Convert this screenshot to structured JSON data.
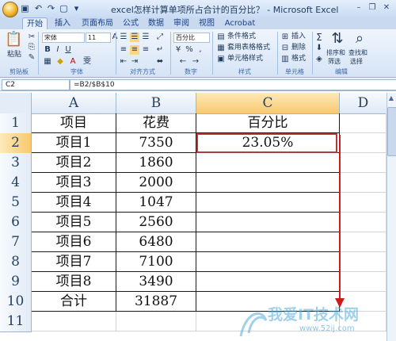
{
  "window": {
    "title": "excel怎样计算单项所占合计的百分比？ - Microsoft Excel",
    "controls": [
      "minimize",
      "restore",
      "close"
    ]
  },
  "tabs": [
    "开始",
    "插入",
    "页面布局",
    "公式",
    "数据",
    "审阅",
    "视图",
    "Acrobat"
  ],
  "active_tab": "开始",
  "ribbon": {
    "clipboard": {
      "paste": "粘贴",
      "label": "剪贴板"
    },
    "font": {
      "name": "宋体",
      "size": "11",
      "label": "字体",
      "bold": "B",
      "italic": "I",
      "underline": "U",
      "grow": "A",
      "color_letter": "A",
      "phonetic": "雯"
    },
    "alignment": {
      "label": "对齐方式"
    },
    "number": {
      "format": "百分比",
      "label": "数字"
    },
    "styles": {
      "conditional": "条件格式",
      "table": "套用表格格式",
      "cell": "单元格样式",
      "label": "样式"
    },
    "cells": {
      "insert": "插入",
      "delete": "删除",
      "format": "格式",
      "label": "单元格"
    },
    "editing": {
      "sum": "Σ",
      "sort": "排序和",
      "sort2": "筛选",
      "find": "查找和",
      "find2": "选择",
      "label": "编辑"
    }
  },
  "formula_bar": {
    "name_box": "C2",
    "formula": "=B2/$B$10"
  },
  "columns": [
    "A",
    "B",
    "C",
    "D"
  ],
  "selected_column": "C",
  "rows": [
    {
      "num": "1",
      "a": "项目",
      "b": "花费",
      "c": "百分比"
    },
    {
      "num": "2",
      "a": "项目1",
      "b": "7350",
      "c": "23.05%"
    },
    {
      "num": "3",
      "a": "项目2",
      "b": "1860",
      "c": ""
    },
    {
      "num": "4",
      "a": "项目3",
      "b": "2000",
      "c": ""
    },
    {
      "num": "5",
      "a": "项目4",
      "b": "1047",
      "c": ""
    },
    {
      "num": "6",
      "a": "项目5",
      "b": "2560",
      "c": ""
    },
    {
      "num": "7",
      "a": "项目6",
      "b": "6480",
      "c": ""
    },
    {
      "num": "8",
      "a": "项目7",
      "b": "7100",
      "c": ""
    },
    {
      "num": "9",
      "a": "项目8",
      "b": "3490",
      "c": ""
    },
    {
      "num": "10",
      "a": "合计",
      "b": "31887",
      "c": ""
    },
    {
      "num": "11",
      "a": "",
      "b": "",
      "c": ""
    }
  ],
  "selected_row": "2",
  "watermark": {
    "text": "我爱IT技术网",
    "url": "www.52ij.com"
  },
  "colors": {
    "selection_border": "#b13a3a",
    "arrow": "#d11a1a",
    "header_selected": "#f9c96e"
  }
}
